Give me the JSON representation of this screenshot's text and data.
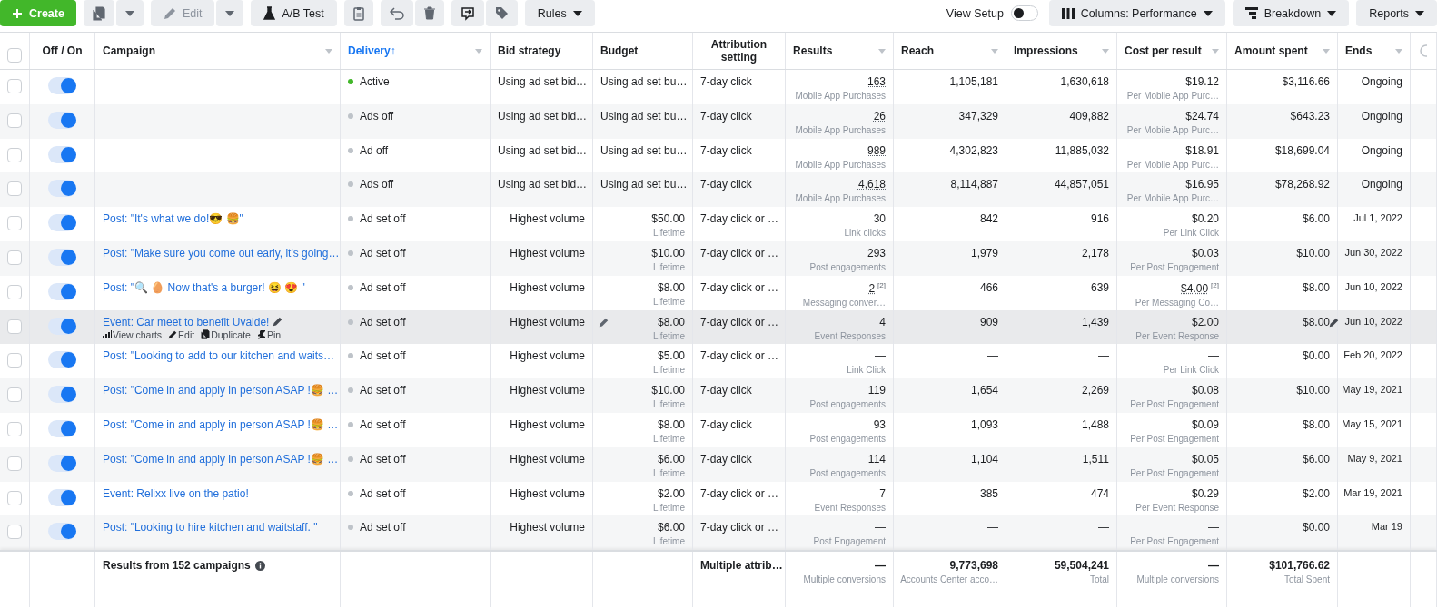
{
  "toolbar": {
    "create": "Create",
    "edit": "Edit",
    "edit_disabled": true,
    "ab_test": "A/B Test",
    "rules": "Rules",
    "view_setup": {
      "label": "View Setup",
      "on": false
    },
    "columns": "Columns: Performance",
    "breakdown": "Breakdown",
    "reports": "Reports"
  },
  "select_all": {
    "checked": false
  },
  "columns": [
    {
      "label": "Off / On",
      "menu": false,
      "selected": false
    },
    {
      "label": "Campaign",
      "menu": true,
      "selected": false
    },
    {
      "label": "Delivery",
      "sort": "↑",
      "menu": true,
      "selected": true
    },
    {
      "label": "Bid strategy",
      "menu": false,
      "selected": false
    },
    {
      "label": "Budget",
      "menu": false,
      "selected": false
    },
    {
      "label": "Attribution setting",
      "menu": false,
      "selected": false
    },
    {
      "label": "Results",
      "menu": true,
      "selected": false
    },
    {
      "label": "Reach",
      "menu": true,
      "selected": false
    },
    {
      "label": "Impressions",
      "menu": true,
      "selected": false
    },
    {
      "label": "Cost per result",
      "menu": true,
      "selected": false
    },
    {
      "label": "Amount spent",
      "menu": true,
      "selected": false
    },
    {
      "label": "Ends",
      "menu": true,
      "selected": false
    }
  ],
  "rows": [
    {
      "selected": false,
      "on": true,
      "hovered": false,
      "status": "Active",
      "color": "#42b72a",
      "bid": "Using ad set bid…",
      "budget": "Using ad set bu…",
      "attribution": "7-day click",
      "results": "163",
      "results_sub": "Mobile App Purchases",
      "underlined": true,
      "reach": "1,105,181",
      "impressions": "1,630,618",
      "cost": "$19.12",
      "cost_sub": "Per Mobile App Purc…",
      "spent": "$3,116.66",
      "ends": "Ongoing"
    },
    {
      "selected": false,
      "on": true,
      "hovered": false,
      "status": "Ads off",
      "color": "#bec3c9",
      "bid": "Using ad set bid…",
      "budget": "Using ad set bu…",
      "attribution": "7-day click",
      "results": "26",
      "results_sub": "Mobile App Purchases",
      "underlined": true,
      "reach": "347,329",
      "impressions": "409,882",
      "cost": "$24.74",
      "cost_sub": "Per Mobile App Purc…",
      "spent": "$643.23",
      "ends": "Ongoing"
    },
    {
      "selected": false,
      "on": true,
      "hovered": false,
      "status": "Ad off",
      "color": "#bec3c9",
      "bid": "Using ad set bid…",
      "budget": "Using ad set bu…",
      "attribution": "7-day click",
      "results": "989",
      "results_sub": "Mobile App Purchases",
      "underlined": true,
      "reach": "4,302,823",
      "impressions": "11,885,032",
      "cost": "$18.91",
      "cost_sub": "Per Mobile App Purc…",
      "spent": "$18,699.04",
      "ends": "Ongoing"
    },
    {
      "selected": false,
      "on": true,
      "hovered": false,
      "status": "Ads off",
      "color": "#bec3c9",
      "bid": "Using ad set bid…",
      "budget": "Using ad set bu…",
      "attribution": "7-day click",
      "results": "4,618",
      "results_sub": "Mobile App Purchases",
      "underlined": true,
      "reach": "8,114,887",
      "impressions": "44,857,051",
      "cost": "$16.95",
      "cost_sub": "Per Mobile App Purc…",
      "spent": "$78,268.92",
      "ends": "Ongoing"
    },
    {
      "selected": false,
      "on": true,
      "hovered": false,
      "campaign": "Post: \"It's what we do!😎 🍔\"",
      "status": "Ad set off",
      "color": "#bec3c9",
      "bid": "Highest volume",
      "budget": "$50.00",
      "budget_sub": "Lifetime",
      "attribution": "7-day click or …",
      "results": "30",
      "results_sub": "Link clicks",
      "underlined": false,
      "reach": "842",
      "impressions": "916",
      "cost": "$0.20",
      "cost_sub": "Per Link Click",
      "spent": "$6.00",
      "ends": "Jul 1, 2022"
    },
    {
      "selected": false,
      "on": true,
      "hovered": false,
      "campaign": "Post: \"Make sure you come out early, it's going…",
      "status": "Ad set off",
      "color": "#bec3c9",
      "bid": "Highest volume",
      "budget": "$10.00",
      "budget_sub": "Lifetime",
      "attribution": "7-day click or …",
      "results": "293",
      "results_sub": "Post engagements",
      "underlined": false,
      "reach": "1,979",
      "impressions": "2,178",
      "cost": "$0.03",
      "cost_sub": "Per Post Engagement",
      "spent": "$10.00",
      "ends": "Jun 30, 2022"
    },
    {
      "selected": false,
      "on": true,
      "hovered": false,
      "campaign": "Post: \"🔍 🥚 Now that's a burger! 😆 😍 \"",
      "status": "Ad set off",
      "color": "#bec3c9",
      "bid": "Highest volume",
      "budget": "$8.00",
      "budget_sub": "Lifetime",
      "attribution": "7-day click or …",
      "results": "2",
      "results_note": "[2]",
      "results_sub": "Messaging conver…",
      "underlined": true,
      "reach": "466",
      "impressions": "639",
      "cost": "$4.00",
      "cost_note": "[2]",
      "cost_underlined": true,
      "cost_sub": "Per Messaging Co…",
      "spent": "$8.00",
      "ends": "Jun 10, 2022"
    },
    {
      "selected": false,
      "on": true,
      "hovered": true,
      "campaign": "Event: Car meet to benefit Uvalde!",
      "actions": [
        "View charts",
        "Edit",
        "Duplicate",
        "Pin"
      ],
      "status": "Ad set off",
      "color": "#bec3c9",
      "bid": "Highest volume",
      "budget": "$8.00",
      "budget_sub": "Lifetime",
      "attribution": "7-day click or …",
      "results": "4",
      "results_sub": "Event Responses",
      "underlined": false,
      "reach": "909",
      "impressions": "1,439",
      "cost": "$2.00",
      "cost_sub": "Per Event Response",
      "spent": "$8.00",
      "ends": "Jun 10, 2022"
    },
    {
      "selected": false,
      "on": true,
      "hovered": false,
      "campaign": "Post: \"Looking to add to our kitchen and waits…",
      "status": "Ad set off",
      "color": "#bec3c9",
      "bid": "Highest volume",
      "budget": "$5.00",
      "budget_sub": "Lifetime",
      "attribution": "7-day click or …",
      "results": "—",
      "results_sub": "Link Click",
      "underlined": false,
      "reach": "—",
      "impressions": "—",
      "cost": "—",
      "cost_sub": "Per Link Click",
      "spent": "$0.00",
      "ends": "Feb 20, 2022"
    },
    {
      "selected": false,
      "on": true,
      "hovered": false,
      "campaign": "Post: \"Come in and apply in person ASAP !🍔 …",
      "status": "Ad set off",
      "color": "#bec3c9",
      "bid": "Highest volume",
      "budget": "$10.00",
      "budget_sub": "Lifetime",
      "attribution": "7-day click",
      "results": "119",
      "results_sub": "Post engagements",
      "underlined": false,
      "reach": "1,654",
      "impressions": "2,269",
      "cost": "$0.08",
      "cost_sub": "Per Post Engagement",
      "spent": "$10.00",
      "ends": "May 19, 2021"
    },
    {
      "selected": false,
      "on": true,
      "hovered": false,
      "campaign": "Post: \"Come in and apply in person ASAP !🍔 …",
      "status": "Ad set off",
      "color": "#bec3c9",
      "bid": "Highest volume",
      "budget": "$8.00",
      "budget_sub": "Lifetime",
      "attribution": "7-day click",
      "results": "93",
      "results_sub": "Post engagements",
      "underlined": false,
      "reach": "1,093",
      "impressions": "1,488",
      "cost": "$0.09",
      "cost_sub": "Per Post Engagement",
      "spent": "$8.00",
      "ends": "May 15, 2021"
    },
    {
      "selected": false,
      "on": true,
      "hovered": false,
      "campaign": "Post: \"Come in and apply in person ASAP !🍔 …",
      "status": "Ad set off",
      "color": "#bec3c9",
      "bid": "Highest volume",
      "budget": "$6.00",
      "budget_sub": "Lifetime",
      "attribution": "7-day click",
      "results": "114",
      "results_sub": "Post engagements",
      "underlined": false,
      "reach": "1,104",
      "impressions": "1,511",
      "cost": "$0.05",
      "cost_sub": "Per Post Engagement",
      "spent": "$6.00",
      "ends": "May 9, 2021"
    },
    {
      "selected": false,
      "on": true,
      "hovered": false,
      "campaign": "Event: Relixx live on the patio!",
      "status": "Ad set off",
      "color": "#bec3c9",
      "bid": "Highest volume",
      "budget": "$2.00",
      "budget_sub": "Lifetime",
      "attribution": "7-day click or …",
      "results": "7",
      "results_sub": "Event Responses",
      "underlined": false,
      "reach": "385",
      "impressions": "474",
      "cost": "$0.29",
      "cost_sub": "Per Event Response",
      "spent": "$2.00",
      "ends": "Mar 19, 2021"
    },
    {
      "selected": false,
      "on": true,
      "hovered": false,
      "campaign": "Post: \"Looking to hire kitchen and waitstaff. \"",
      "status": "Ad set off",
      "color": "#bec3c9",
      "bid": "Highest volume",
      "budget": "$6.00",
      "budget_sub": "Lifetime",
      "attribution": "7-day click or …",
      "results": "—",
      "results_sub": "Post Engagement",
      "underlined": false,
      "reach": "—",
      "impressions": "—",
      "cost": "—",
      "cost_sub": "Per Post Engagement",
      "spent": "$0.00",
      "ends": "Mar 19"
    }
  ],
  "footer": {
    "summary": "Results from 152 campaigns",
    "attribution": "Multiple attrib…",
    "results": {
      "value": "—",
      "sub": "Multiple conversions"
    },
    "reach": {
      "value": "9,773,698",
      "sub": "Accounts Center acco…"
    },
    "impressions": {
      "value": "59,504,241",
      "sub": "Total"
    },
    "cost": {
      "value": "—",
      "sub": "Multiple conversions"
    },
    "spent": {
      "value": "$101,766.62",
      "sub": "Total Spent"
    }
  }
}
